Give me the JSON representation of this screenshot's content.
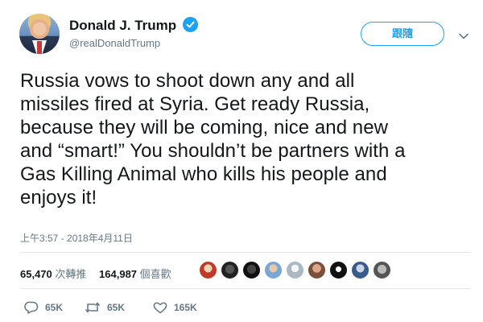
{
  "tweet": {
    "author_name": "Donald J. Trump",
    "handle": "@realDonaldTrump",
    "follow_label": "跟隨",
    "text_lines": [
      "Russia vows to shoot down any and all",
      "missiles fired at Syria. Get ready Russia,",
      "because they will be coming, nice and new",
      "and “smart!” You shouldn’t be partners with a",
      "Gas Killing Animal who kills his people and",
      "enjoys it!"
    ],
    "timestamp": "上午3:57 - 2018年4月11日"
  },
  "stats": {
    "retweets_count": "65,470",
    "retweets_label": "次轉推",
    "likes_count": "164,987",
    "likes_label": "個喜歡"
  },
  "actions": {
    "reply_count": "65K",
    "retweet_count": "65K",
    "like_count": "165K"
  },
  "colors": {
    "accent": "#1da1f2",
    "secondary_text": "#657786",
    "primary_text": "#14171a",
    "divider": "#e1e8ed"
  },
  "icons": [
    "verified-badge-icon",
    "chevron-down-icon",
    "reply-icon",
    "retweet-icon",
    "like-icon"
  ]
}
